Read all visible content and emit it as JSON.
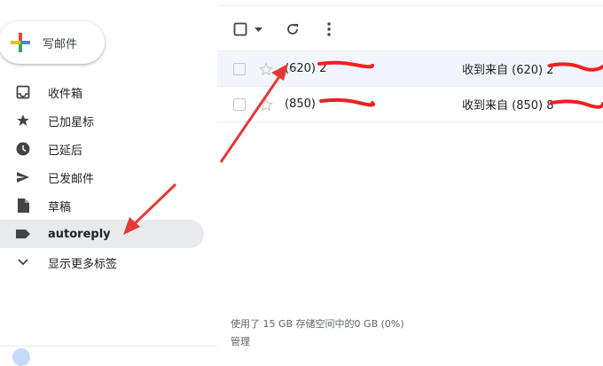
{
  "compose": {
    "label": "写邮件"
  },
  "nav": {
    "items": [
      {
        "label": "收件箱",
        "icon": "inbox-icon"
      },
      {
        "label": "已加星标",
        "icon": "star-icon"
      },
      {
        "label": "已延后",
        "icon": "clock-icon"
      },
      {
        "label": "已发邮件",
        "icon": "send-icon"
      },
      {
        "label": "草稿",
        "icon": "draft-icon"
      },
      {
        "label": "autoreply",
        "icon": "label-icon",
        "active": true
      },
      {
        "label": "显示更多标签",
        "icon": "chevron-down-icon"
      }
    ]
  },
  "toolbar": {
    "select_all_icon": "checkbox-icon",
    "select_menu_icon": "caret-down-icon",
    "refresh_icon": "refresh-icon",
    "more_icon": "more-vert-icon"
  },
  "emails": [
    {
      "sender": "(620) 2",
      "subject": "收到来自 (620) 2"
    },
    {
      "sender": "(850) ",
      "subject": "收到来自 (850) 8"
    }
  ],
  "footer": {
    "storage": "使用了 15 GB 存储空间中的0 GB (0%)",
    "manage": "管理"
  },
  "colors": {
    "accent_red": "#ea4335",
    "accent_blue": "#4285f4",
    "accent_yellow": "#fbbc04",
    "accent_green": "#34a853",
    "annotation_red": "#e53935",
    "active_bg": "#e8eaed"
  }
}
